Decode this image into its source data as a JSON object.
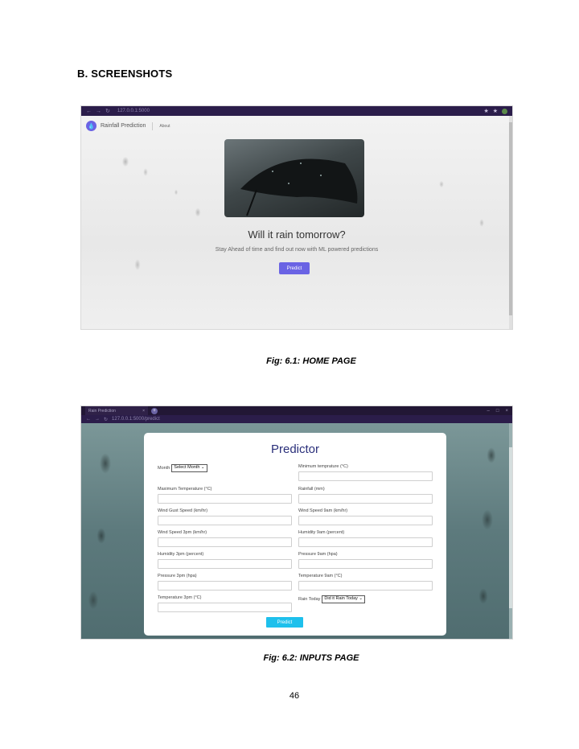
{
  "document": {
    "section_heading": "B.   SCREENSHOTS",
    "figure1_caption": "Fig: 6.1: HOME PAGE",
    "figure2_caption": "Fig: 6.2: INPUTS PAGE",
    "page_number": "46"
  },
  "home_page": {
    "browser": {
      "url": "127.0.0.1:5000"
    },
    "brand": "Rainfall Prediction",
    "nav_about": "About",
    "headline": "Will it rain tomorrow?",
    "subheadline": "Stay Ahead of time and find out now with ML powered predictions",
    "predict_button": "Predict",
    "accent_color": "#6a63e4"
  },
  "inputs_page": {
    "browser": {
      "tab_title": "Rain Prediction",
      "url": "127.0.0.1:5000/predict"
    },
    "title": "Predictor",
    "month_label": "Month",
    "month_select": "Select Month",
    "fields": {
      "min_temp": "Minimum temprature (°C)",
      "max_temp": "Maximum Temperature (°C)",
      "rainfall": "Rainfall (mm)",
      "wind_gust": "Wind Gust Speed (km/hr)",
      "wind_9am": "Wind Speed 9am (km/hr)",
      "wind_3pm": "Wind Speed 3pm (km/hr)",
      "humidity_9am": "Humidity 9am (percent)",
      "humidity_3pm": "Humidity 3pm (percent)",
      "pressure_9am": "Pressure 9am (hpa)",
      "pressure_3pm": "Pressure 3pm (hpa)",
      "temp_9am": "Temperature 9am (°C)",
      "temp_3pm": "Temperature 3pm (°C)"
    },
    "rain_today_label": "Rain Today",
    "rain_today_select": "Did it Rain Today",
    "predict_button": "Predict",
    "accent_color": "#1ec0ec"
  }
}
